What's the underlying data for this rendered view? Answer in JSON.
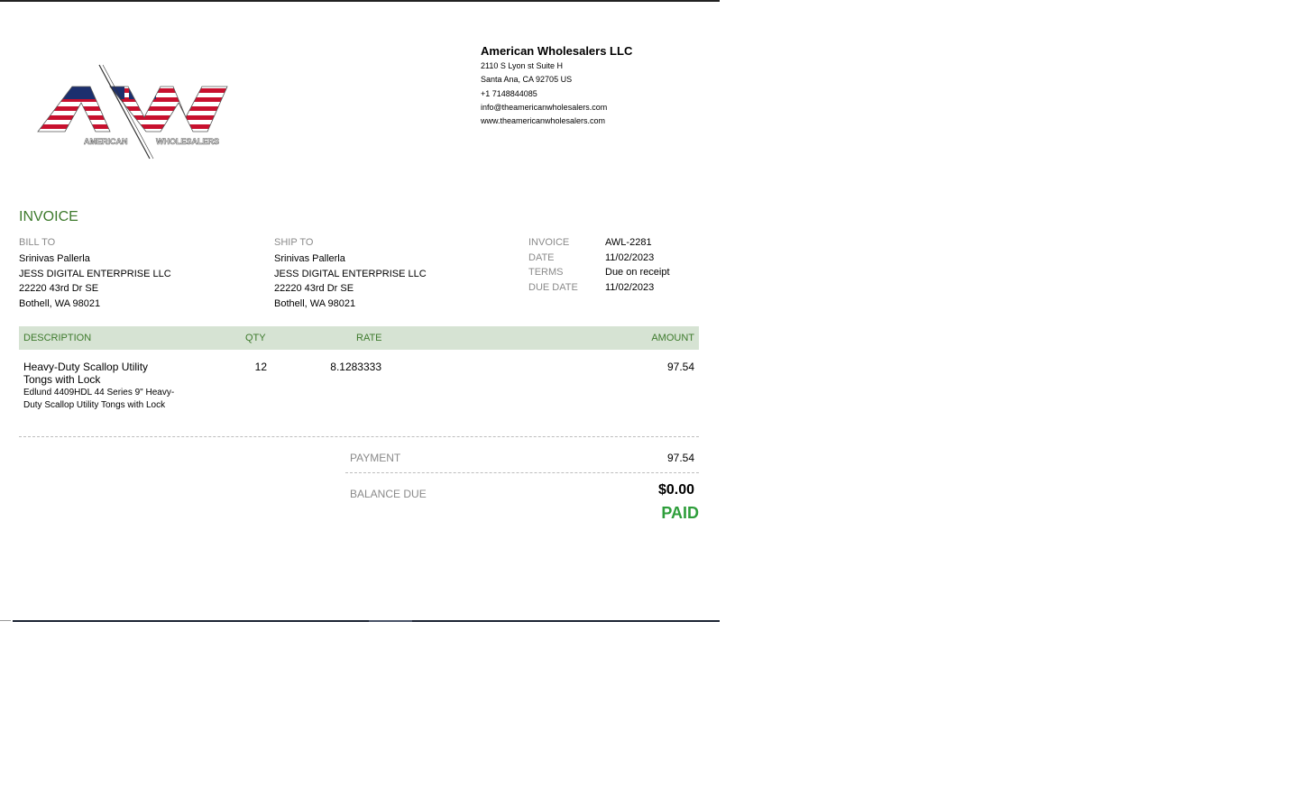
{
  "logo": {
    "letters": "AW",
    "text_left": "AMERICAN",
    "text_right": "WHOLESALERS"
  },
  "company": {
    "name": "American Wholesalers LLC",
    "address1": "2110 S Lyon st Suite H",
    "address2": "Santa Ana, CA  92705 US",
    "phone": "+1 7148844085",
    "email": "info@theamericanwholesalers.com",
    "website": "www.theamericanwholesalers.com"
  },
  "invoice_title": "INVOICE",
  "bill_to": {
    "label": "BILL TO",
    "name": "Srinivas Pallerla",
    "company": "JESS DIGITAL ENTERPRISE LLC",
    "street": "22220 43rd Dr SE",
    "city": "Bothell, WA  98021"
  },
  "ship_to": {
    "label": "SHIP TO",
    "name": "Srinivas Pallerla",
    "company": "JESS DIGITAL ENTERPRISE LLC",
    "street": "22220 43rd Dr SE",
    "city": "Bothell, WA  98021"
  },
  "meta": {
    "invoice_label": "INVOICE",
    "invoice_value": "AWL-2281",
    "date_label": "DATE",
    "date_value": "11/02/2023",
    "terms_label": "TERMS",
    "terms_value": "Due on receipt",
    "due_label": "DUE DATE",
    "due_value": "11/02/2023"
  },
  "table": {
    "headers": {
      "description": "DESCRIPTION",
      "qty": "QTY",
      "rate": "RATE",
      "amount": "AMOUNT"
    },
    "items": [
      {
        "name": "Heavy-Duty Scallop Utility Tongs with Lock",
        "description": "Edlund 4409HDL 44 Series 9\" Heavy-Duty Scallop Utility Tongs with Lock",
        "qty": "12",
        "rate": "8.1283333",
        "amount": "97.54"
      }
    ]
  },
  "totals": {
    "payment_label": "PAYMENT",
    "payment_value": "97.54",
    "balance_label": "BALANCE DUE",
    "balance_value": "$0.00",
    "status": "PAID"
  },
  "colors": {
    "accent_green": "#3d7a2c",
    "header_bg": "#d6e3d3",
    "paid_green": "#2e9e3b",
    "flag_red": "#c8102e",
    "flag_blue": "#1c2f6e"
  }
}
